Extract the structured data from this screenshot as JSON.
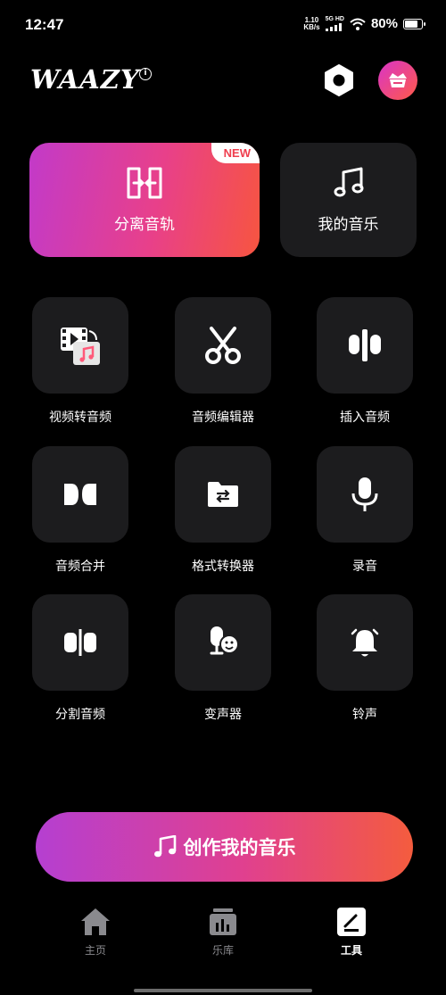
{
  "status": {
    "time": "12:47",
    "net_speed_value": "1.10",
    "net_speed_unit": "KB/s",
    "net_type": "5G HD",
    "battery": "80%",
    "battery_level": 0.8
  },
  "header": {
    "logo": "WAAZY"
  },
  "cards": {
    "separate": {
      "label": "分离音轨",
      "badge": "NEW"
    },
    "my_music": {
      "label": "我的音乐"
    }
  },
  "tools": [
    {
      "label": "视频转音频",
      "icon": "video-to-audio-icon"
    },
    {
      "label": "音频编辑器",
      "icon": "scissors-icon"
    },
    {
      "label": "插入音频",
      "icon": "insert-audio-icon"
    },
    {
      "label": "音频合并",
      "icon": "merge-audio-icon"
    },
    {
      "label": "格式转换器",
      "icon": "folder-convert-icon"
    },
    {
      "label": "录音",
      "icon": "microphone-icon"
    },
    {
      "label": "分割音频",
      "icon": "split-audio-icon"
    },
    {
      "label": "变声器",
      "icon": "voice-changer-icon"
    },
    {
      "label": "铃声",
      "icon": "bell-icon"
    }
  ],
  "cta": {
    "label": "创作我的音乐"
  },
  "nav": [
    {
      "label": "主页",
      "icon": "home-icon"
    },
    {
      "label": "乐库",
      "icon": "library-icon"
    },
    {
      "label": "工具",
      "icon": "tools-icon"
    }
  ],
  "colors": {
    "accent_start": "#c23ac9",
    "accent_end": "#f75540",
    "card_bg": "#1c1c1e"
  }
}
